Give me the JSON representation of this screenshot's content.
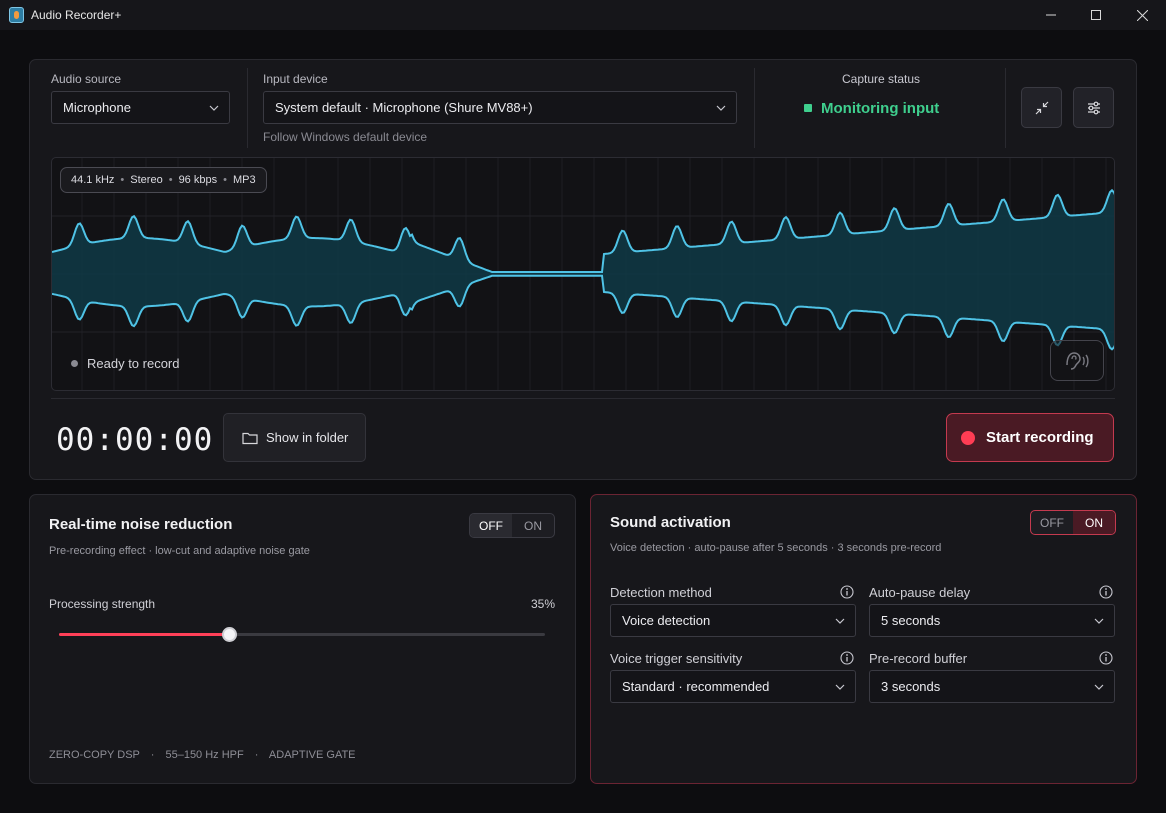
{
  "window": {
    "title": "Audio Recorder+"
  },
  "source": {
    "audio_source_label": "Audio source",
    "audio_source_value": "Microphone",
    "input_device_label": "Input device",
    "input_device_value": "System default · Microphone (Shure MV88+)",
    "input_device_hint": "Follow Windows default device"
  },
  "capture": {
    "title": "Capture status",
    "status": "Monitoring input",
    "status_color": "#3fcf8e"
  },
  "waveform": {
    "format": {
      "rate": "44.1 kHz",
      "channels": "Stereo",
      "bitrate": "96 kbps",
      "codec": "MP3"
    },
    "ready_text": "Ready to record",
    "color": "#4fc3e6"
  },
  "transport": {
    "timer": "00:00:00",
    "show_folder_label": "Show in folder",
    "record_label": "Start recording",
    "record_color": "#ff3d54"
  },
  "noise_reduction": {
    "title": "Real-time noise reduction",
    "subtitle": "Pre-recording effect · low-cut and adaptive noise gate",
    "toggle_off": "OFF",
    "toggle_on": "ON",
    "state": "OFF",
    "strength_label": "Processing strength",
    "strength_value_text": "35%",
    "strength_fraction": 0.35,
    "tags": [
      "ZERO-COPY DSP",
      "55–150 Hz HPF",
      "ADAPTIVE GATE"
    ],
    "tag_sep": "·"
  },
  "sound_activation": {
    "title": "Sound activation",
    "subtitle": "Voice detection · auto-pause after 5 seconds · 3 seconds pre-record",
    "toggle_off": "OFF",
    "toggle_on": "ON",
    "state": "ON",
    "detection_method_label": "Detection method",
    "detection_method_value": "Voice detection",
    "auto_pause_label": "Auto-pause delay",
    "auto_pause_value": "5 seconds",
    "sensitivity_label": "Voice trigger sensitivity",
    "sensitivity_value": "Standard · recommended",
    "pre_record_label": "Pre-record buffer",
    "pre_record_value": "3 seconds"
  }
}
